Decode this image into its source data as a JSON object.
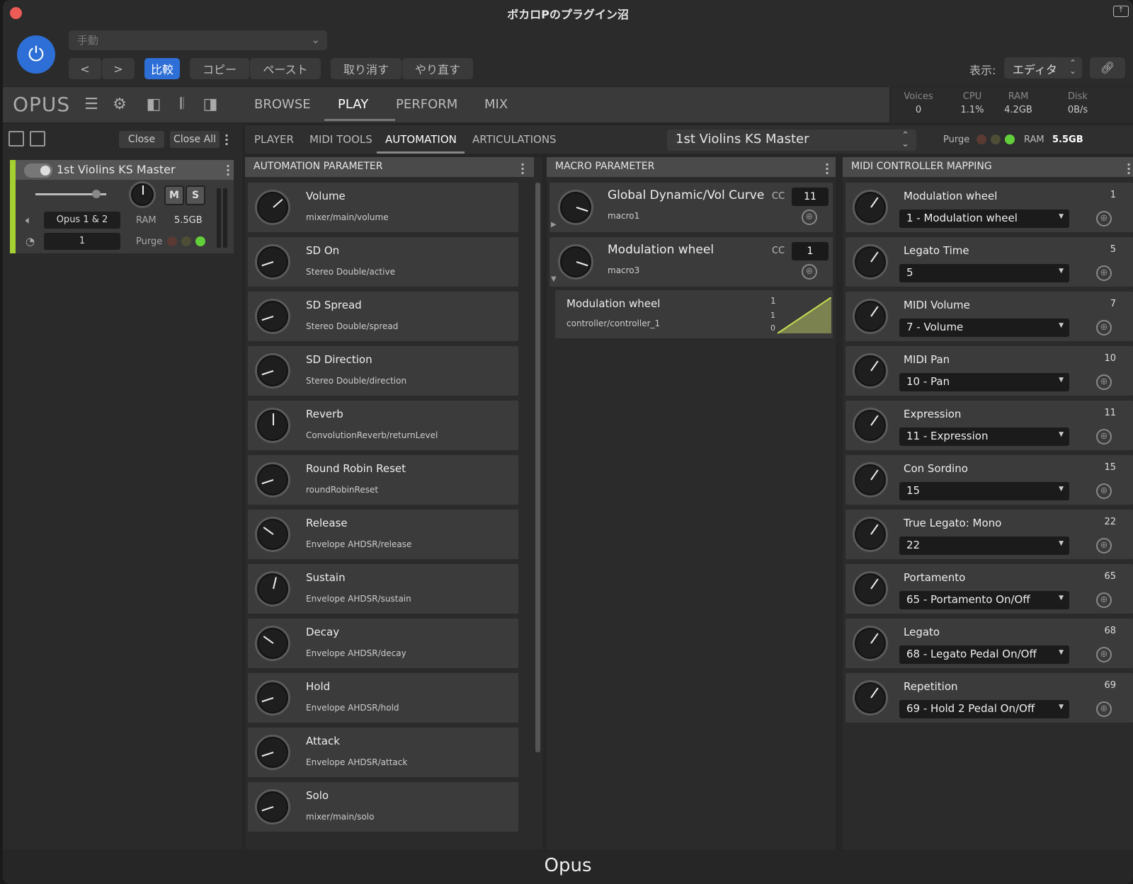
{
  "window": {
    "title": "ボカロPのプラグイン沼",
    "footer": "Opus"
  },
  "host": {
    "preset": "手動",
    "buttons": {
      "back": "<",
      "forward": ">",
      "compare": "比較",
      "copy": "コピー",
      "paste": "ペースト",
      "undo": "取り消す",
      "redo": "やり直す"
    },
    "view_label": "表示:",
    "view_value": "エディタ"
  },
  "header": {
    "logo": "OPUS",
    "nav": [
      "BROWSE",
      "PLAY",
      "PERFORM",
      "MIX"
    ],
    "active_nav": "PLAY",
    "stats": [
      {
        "k": "Voices",
        "v": "0"
      },
      {
        "k": "CPU",
        "v": "1.1%"
      },
      {
        "k": "RAM",
        "v": "4.2GB"
      },
      {
        "k": "Disk",
        "v": "0B/s"
      }
    ]
  },
  "left": {
    "close": "Close",
    "close_all": "Close All",
    "instrument": {
      "name": "1st Violins KS Master",
      "mute": "M",
      "solo": "S",
      "output": "Opus 1 & 2",
      "channel": "1",
      "ram_label": "RAM",
      "ram_value": "5.5GB",
      "purge_label": "Purge",
      "accent": "#a6cf32"
    }
  },
  "subtabs": {
    "items": [
      "PLAYER",
      "MIDI TOOLS",
      "AUTOMATION",
      "ARTICULATIONS"
    ],
    "active": "AUTOMATION",
    "instrument_select": "1st Violins KS Master",
    "purge_label": "Purge",
    "ram_label": "RAM",
    "ram_value": "5.5GB"
  },
  "automation": {
    "title": "AUTOMATION PARAMETER",
    "items": [
      {
        "name": "Volume",
        "path": "mixer/main/volume",
        "level": 0.68
      },
      {
        "name": "SD On",
        "path": "Stereo Double/active",
        "level": 0.1
      },
      {
        "name": "SD Spread",
        "path": "Stereo Double/spread",
        "level": 0.1
      },
      {
        "name": "SD Direction",
        "path": "Stereo Double/direction",
        "level": 0.1
      },
      {
        "name": "Reverb",
        "path": "ConvolutionReverb/returnLevel",
        "level": 0.5
      },
      {
        "name": "Round Robin Reset",
        "path": "roundRobinReset",
        "level": 0.1
      },
      {
        "name": "Release",
        "path": "Envelope AHDSR/release",
        "level": 0.3
      },
      {
        "name": "Sustain",
        "path": "Envelope AHDSR/sustain",
        "level": 0.55
      },
      {
        "name": "Decay",
        "path": "Envelope AHDSR/decay",
        "level": 0.3
      },
      {
        "name": "Hold",
        "path": "Envelope AHDSR/hold",
        "level": 0.1
      },
      {
        "name": "Attack",
        "path": "Envelope AHDSR/attack",
        "level": 0.1
      },
      {
        "name": "Solo",
        "path": "mixer/main/solo",
        "level": 0.1
      }
    ]
  },
  "macro": {
    "title": "MACRO PARAMETER",
    "cc_label": "CC",
    "items": [
      {
        "name": "Global Dynamic/Vol Curve",
        "sub": "macro1",
        "cc": "11",
        "level": 0.9
      },
      {
        "name": "Modulation wheel",
        "sub": "macro3",
        "cc": "1",
        "level": 0.9
      }
    ],
    "mapping": {
      "name": "Modulation wheel",
      "path": "controller/controller_1",
      "top": "1",
      "mid": "1",
      "bottom": "0"
    }
  },
  "midi": {
    "title": "MIDI CONTROLLER MAPPING",
    "items": [
      {
        "name": "Modulation wheel",
        "num": "1",
        "value": "1 - Modulation wheel"
      },
      {
        "name": "Legato Time",
        "num": "5",
        "value": "5"
      },
      {
        "name": "MIDI Volume",
        "num": "7",
        "value": "7 - Volume"
      },
      {
        "name": "MIDI Pan",
        "num": "10",
        "value": "10 - Pan"
      },
      {
        "name": "Expression",
        "num": "11",
        "value": "11 - Expression"
      },
      {
        "name": "Con Sordino",
        "num": "15",
        "value": "15"
      },
      {
        "name": "True Legato: Mono",
        "num": "22",
        "value": "22"
      },
      {
        "name": "Portamento",
        "num": "65",
        "value": "65 - Portamento On/Off"
      },
      {
        "name": "Legato",
        "num": "68",
        "value": "68 - Legato Pedal On/Off"
      },
      {
        "name": "Repetition",
        "num": "69",
        "value": "69 - Hold 2 Pedal On/Off"
      }
    ]
  },
  "colors": {
    "accent_blue": "#2d6fd6",
    "close_red": "#ec5b55",
    "green": "#a6cf32"
  }
}
